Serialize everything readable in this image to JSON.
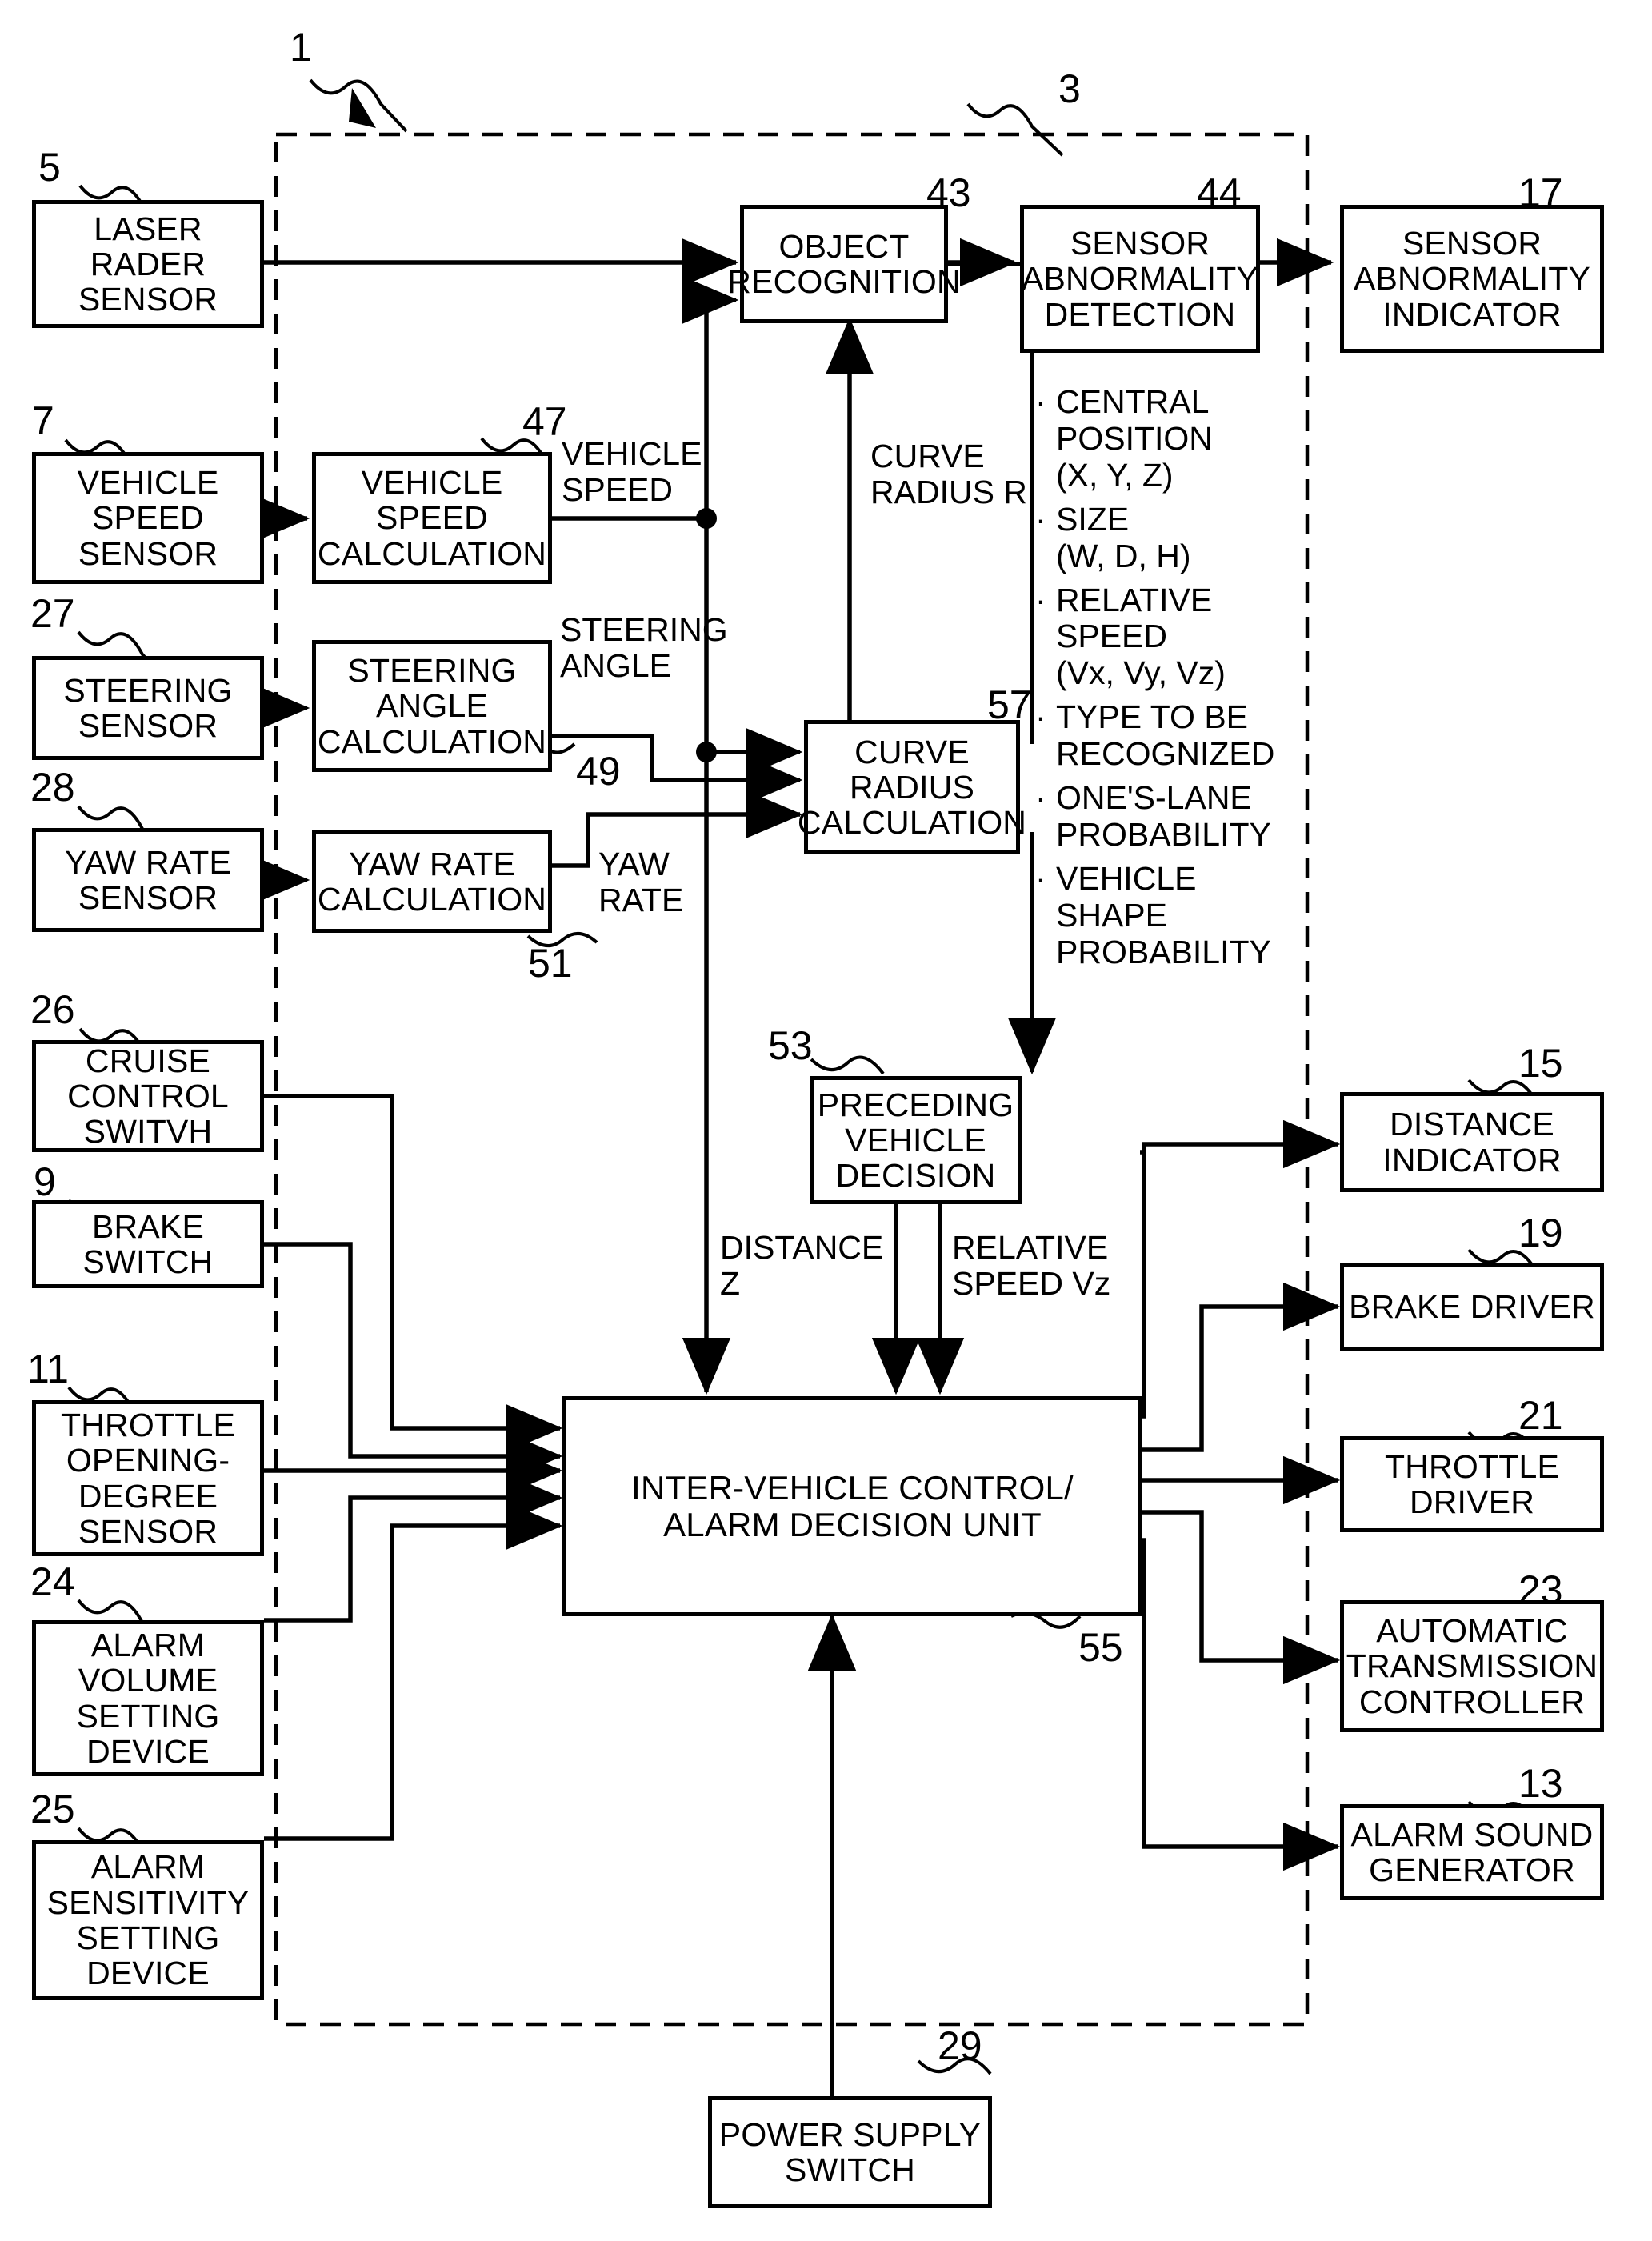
{
  "figure": {
    "ref_system": "1",
    "ref_dashed_enclosure": "3"
  },
  "blocks": {
    "laser_radar_sensor": {
      "label": "LASER\nRADER\nSENSOR",
      "ref": "5"
    },
    "vehicle_speed_sensor": {
      "label": "VEHICLE\nSPEED\nSENSOR",
      "ref": "7"
    },
    "steering_sensor": {
      "label": "STEERING\nSENSOR",
      "ref": "27"
    },
    "yaw_rate_sensor": {
      "label": "YAW RATE\nSENSOR",
      "ref": "28"
    },
    "cruise_control_switch": {
      "label": "CRUISE\nCONTROL\nSWITVH",
      "ref": "26"
    },
    "brake_switch": {
      "label": "BRAKE\nSWITCH",
      "ref": "9"
    },
    "throttle_opening_sensor": {
      "label": "THROTTLE\nOPENING-\nDEGREE\nSENSOR",
      "ref": "11"
    },
    "alarm_volume_setting": {
      "label": "ALARM\nVOLUME\nSETTING\nDEVICE",
      "ref": "24"
    },
    "alarm_sensitivity_setting": {
      "label": "ALARM\nSENSITIVITY\nSETTING\nDEVICE",
      "ref": "25"
    },
    "vehicle_speed_calc": {
      "label": "VEHICLE\nSPEED\nCALCULATION",
      "ref": "47"
    },
    "steering_angle_calc": {
      "label": "STEERING\nANGLE\nCALCULATION",
      "ref": "49"
    },
    "yaw_rate_calc": {
      "label": "YAW RATE\nCALCULATION",
      "ref": "51"
    },
    "object_recognition": {
      "label": "OBJECT\nRECOGNITION",
      "ref": "43"
    },
    "sensor_abnormality_detection": {
      "label": "SENSOR\nABNORMALITY\nDETECTION",
      "ref": "44"
    },
    "sensor_abnormality_indicator": {
      "label": "SENSOR\nABNORMALITY\nINDICATOR",
      "ref": "17"
    },
    "curve_radius_calc": {
      "label": "CURVE\nRADIUS\nCALCULATION",
      "ref": "57"
    },
    "preceding_vehicle_decision": {
      "label": "PRECEDING\nVEHICLE\nDECISION",
      "ref": "53"
    },
    "inter_vehicle_control_unit": {
      "label": "INTER-VEHICLE CONTROL/\nALARM DECISION UNIT",
      "ref": "55"
    },
    "distance_indicator": {
      "label": "DISTANCE\nINDICATOR",
      "ref": "15"
    },
    "brake_driver": {
      "label": "BRAKE  DRIVER",
      "ref": "19"
    },
    "throttle_driver": {
      "label": "THROTTLE\nDRIVER",
      "ref": "21"
    },
    "automatic_transmission_controller": {
      "label": "AUTOMATIC\nTRANSMISSION\nCONTROLLER",
      "ref": "23"
    },
    "alarm_sound_generator": {
      "label": "ALARM SOUND\nGENERATOR",
      "ref": "13"
    },
    "power_supply_switch": {
      "label": "POWER SUPPLY\nSWITCH",
      "ref": "29"
    }
  },
  "signal_labels": {
    "vehicle_speed": "VEHICLE\nSPEED",
    "steering_angle": "STEERING\nANGLE",
    "yaw_rate": "YAW\nRATE",
    "curve_radius_r": "CURVE\nRADIUS R",
    "distance_z": "DISTANCE\nZ",
    "relative_speed_vz": "RELATIVE\nSPEED Vz"
  },
  "recognition_outputs": {
    "bullet": "·",
    "items": [
      "CENTRAL\nPOSITION\n(X, Y, Z)",
      "SIZE\n(W, D, H)",
      "RELATIVE\nSPEED\n(Vx, Vy, Vz)",
      "TYPE TO BE\nRECOGNIZED",
      "ONE'S-LANE\nPROBABILITY",
      "VEHICLE\nSHAPE\nPROBABILITY"
    ]
  },
  "colors": {
    "ink": "#000000",
    "paper": "#ffffff"
  }
}
